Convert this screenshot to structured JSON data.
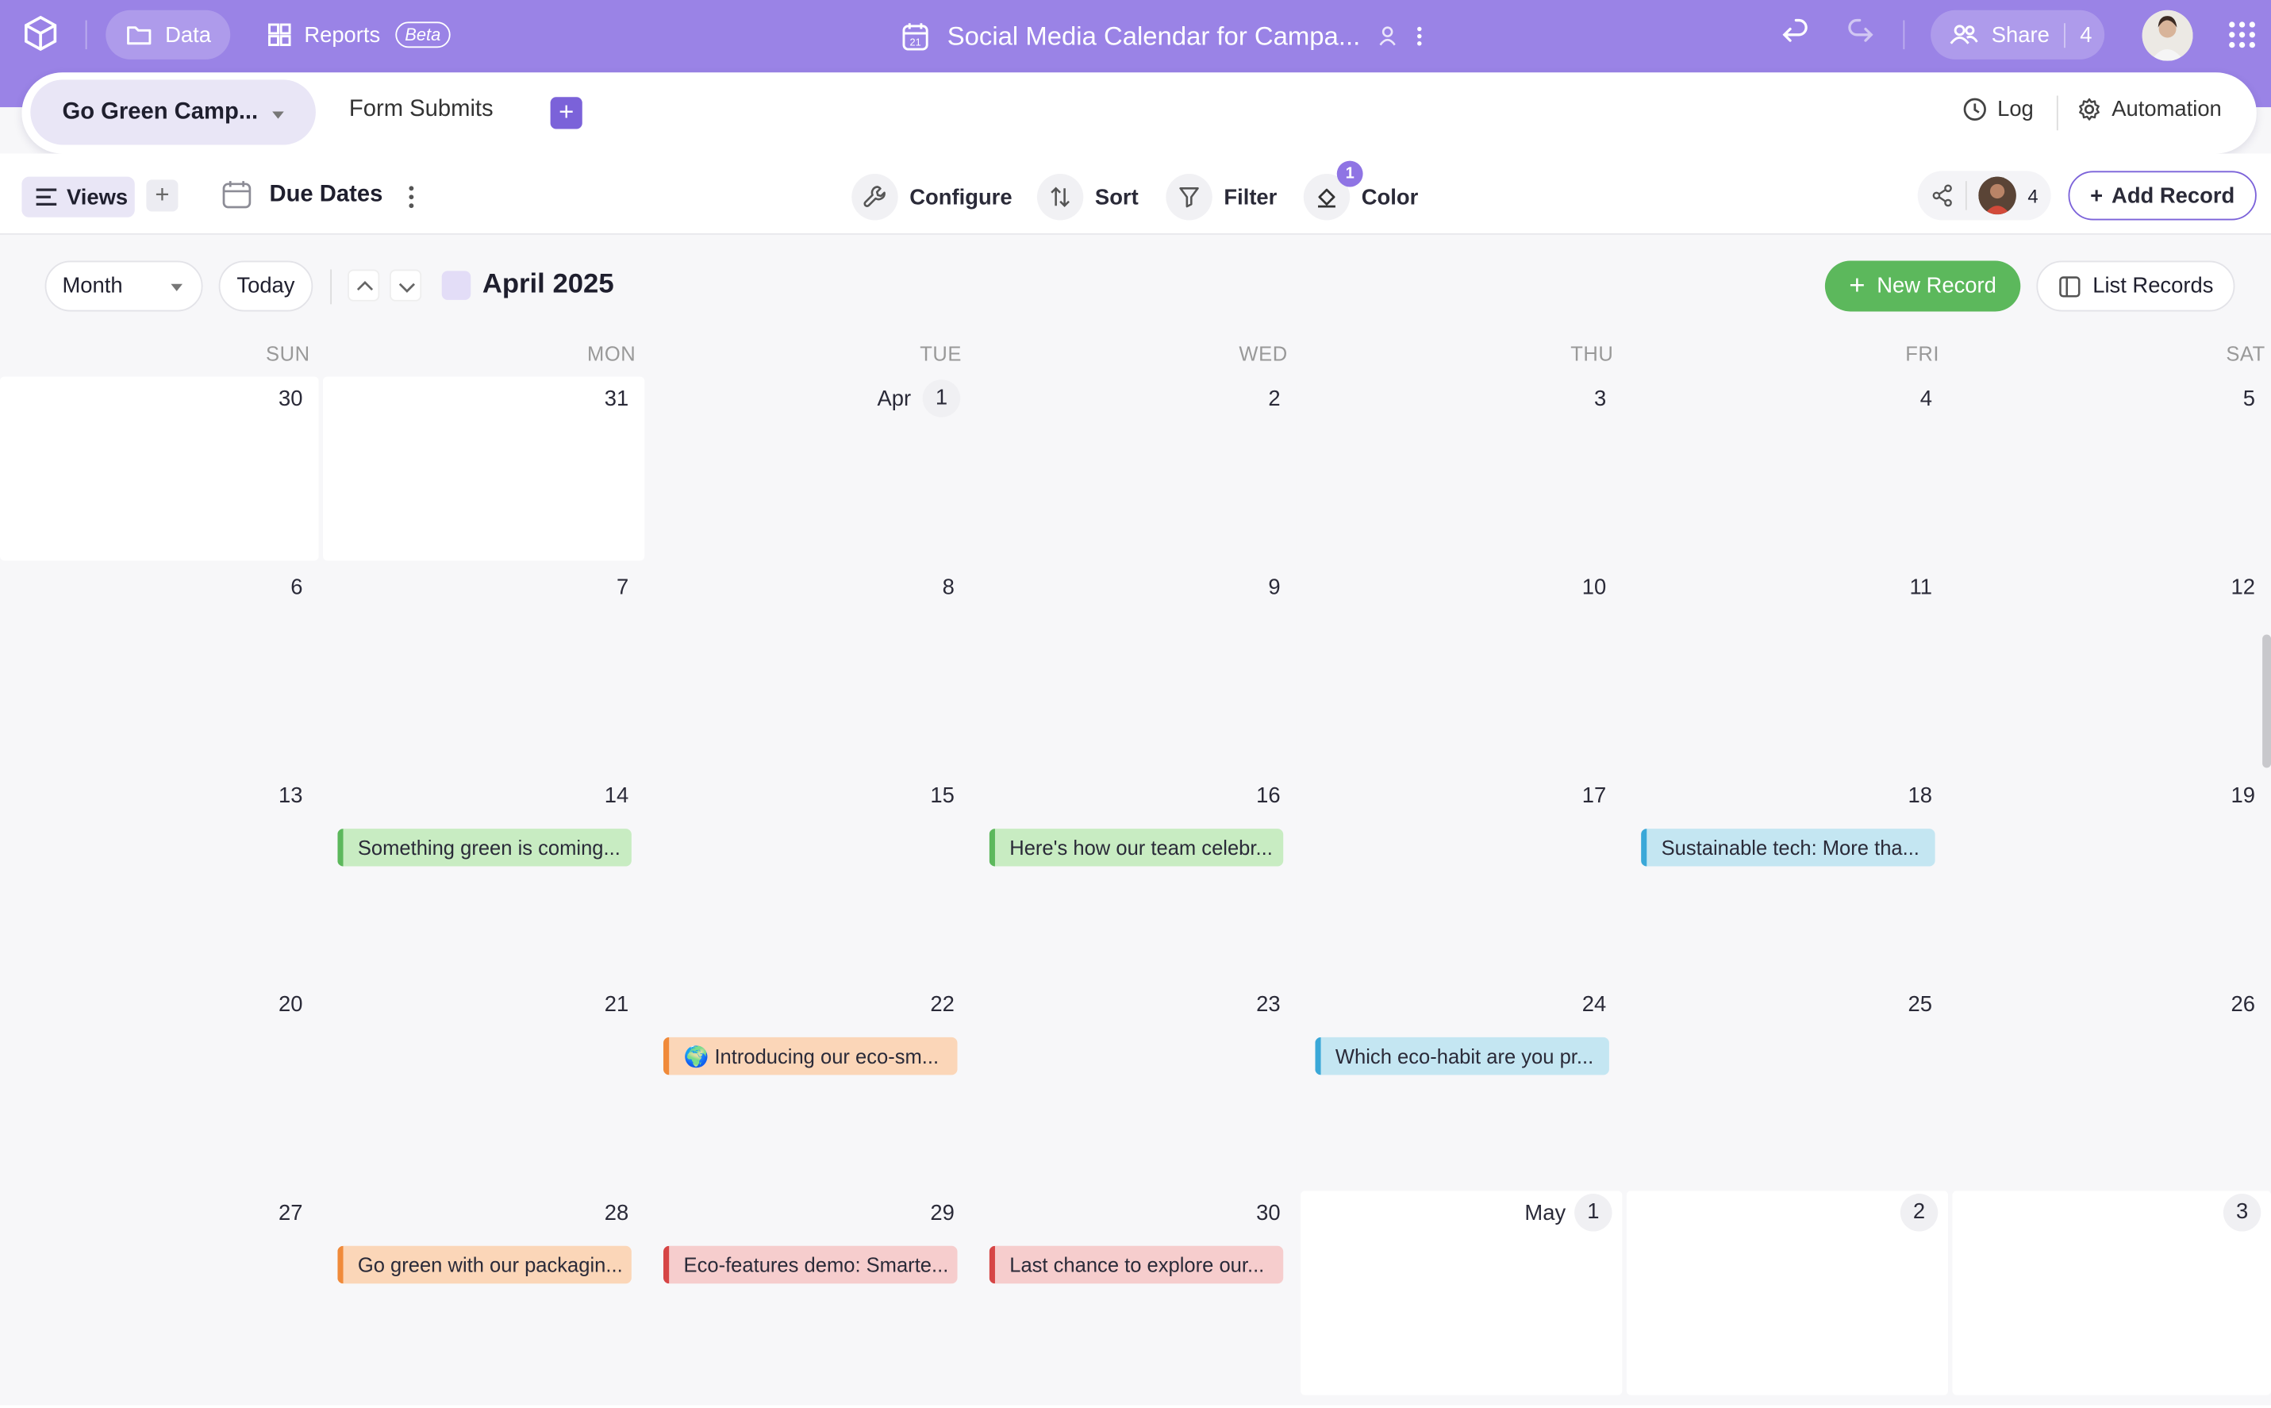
{
  "topbar": {
    "data_label": "Data",
    "reports_label": "Reports",
    "beta_label": "Beta",
    "base_title": "Social Media Calendar for Campa...",
    "share_label": "Share",
    "share_count": "4"
  },
  "tabs": {
    "active_label": "Go Green Camp...",
    "form_label": "Form Submits",
    "add_label": "+",
    "log_label": "Log",
    "automation_label": "Automation"
  },
  "toolbar": {
    "views_label": "Views",
    "view_name": "Due Dates",
    "configure_label": "Configure",
    "sort_label": "Sort",
    "filter_label": "Filter",
    "color_label": "Color",
    "color_badge": "1",
    "collaborators_count": "4",
    "add_record_label": "Add Record"
  },
  "calendar": {
    "mode": "Month",
    "today_label": "Today",
    "title": "April 2025",
    "new_record_label": "New Record",
    "list_records_label": "List Records",
    "weekdays": [
      "SUN",
      "MON",
      "TUE",
      "WED",
      "THU",
      "FRI",
      "SAT"
    ],
    "weeks": [
      [
        "30",
        "31",
        "1",
        "2",
        "3",
        "4",
        "5"
      ],
      [
        "6",
        "7",
        "8",
        "9",
        "10",
        "11",
        "12"
      ],
      [
        "13",
        "14",
        "15",
        "16",
        "17",
        "18",
        "19"
      ],
      [
        "20",
        "21",
        "22",
        "23",
        "24",
        "25",
        "26"
      ],
      [
        "27",
        "28",
        "29",
        "30",
        "1",
        "2",
        "3"
      ]
    ],
    "month_markers": {
      "apr": "Apr",
      "may": "May"
    },
    "events": {
      "apr14": "Something green is coming...",
      "apr16": "Here's how our team celebr...",
      "apr18": "Sustainable tech: More tha...",
      "apr22": "🌍 Introducing our eco-sm...",
      "apr24": "Which eco-habit are you pr...",
      "apr28": "Go green with our packagin...",
      "apr29": "Eco-features demo: Smarte...",
      "apr30": "Last chance to explore our..."
    },
    "event_colors": {
      "green": "#c8ecc2",
      "green_bar": "#5cb85c",
      "blue": "#c4e6f2",
      "blue_bar": "#3aa8d8",
      "orange": "#fbd6b8",
      "orange_bar": "#f08a3a",
      "red": "#f6cdcd",
      "red_bar": "#d64545"
    }
  },
  "colors": {
    "brand_bar": "#9a83e6",
    "accent": "#7b62d9",
    "new_record": "#5cb85c"
  }
}
